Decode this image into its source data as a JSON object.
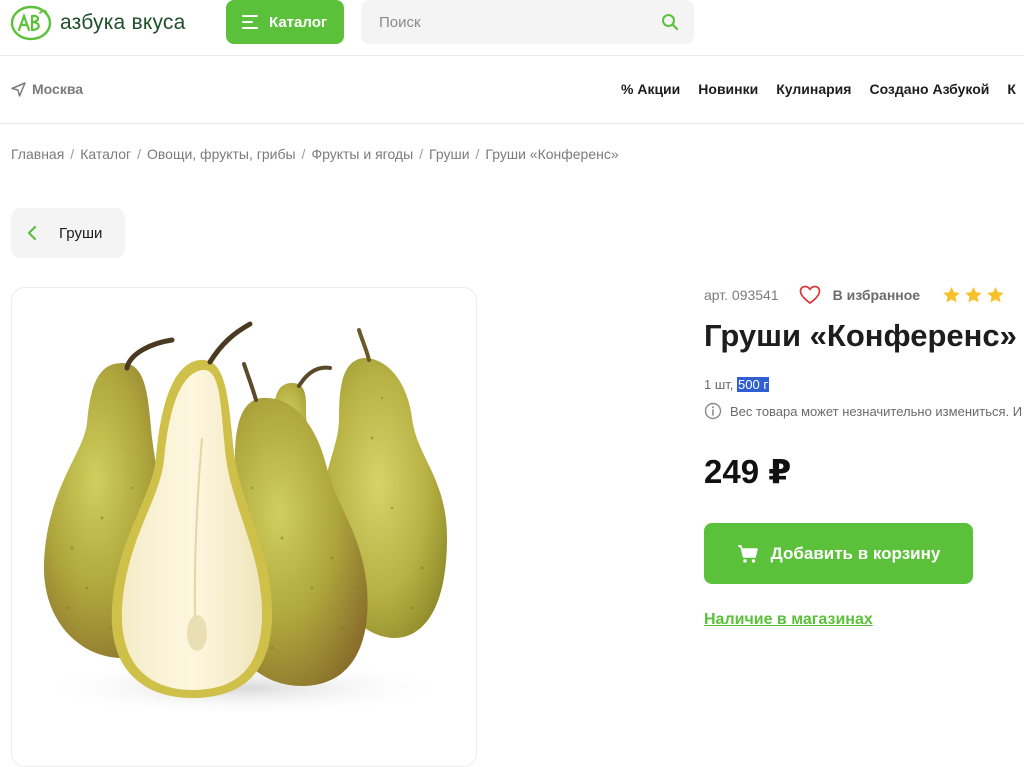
{
  "brand": {
    "name": "азбука вкуса",
    "color": "#1f4f2b",
    "accent": "#5cc13a"
  },
  "header": {
    "catalog_label": "Каталог",
    "search_placeholder": "Поиск"
  },
  "subheader": {
    "city": "Москва",
    "nav": [
      "% Акции",
      "Новинки",
      "Кулинария",
      "Создано Азбукой",
      "К"
    ]
  },
  "breadcrumb": [
    "Главная",
    "Каталог",
    "Овощи, фрукты, грибы",
    "Фрукты и ягоды",
    "Груши",
    "Груши «Конференс»"
  ],
  "back_button": {
    "label": "Груши",
    "icon": "chevron-left-icon"
  },
  "product": {
    "article": "арт. 093541",
    "favorite_label": "В избранное",
    "rating_stars_visible": 3,
    "title": "Груши «Конференс»",
    "unit_prefix": "1 шт,",
    "unit_weight": "500 г",
    "weight_note": "Вес товара может незначительно измениться. И",
    "price": "249 ₽",
    "add_to_cart_label": "Добавить в корзину",
    "stores_link": "Наличие в магазинах"
  }
}
